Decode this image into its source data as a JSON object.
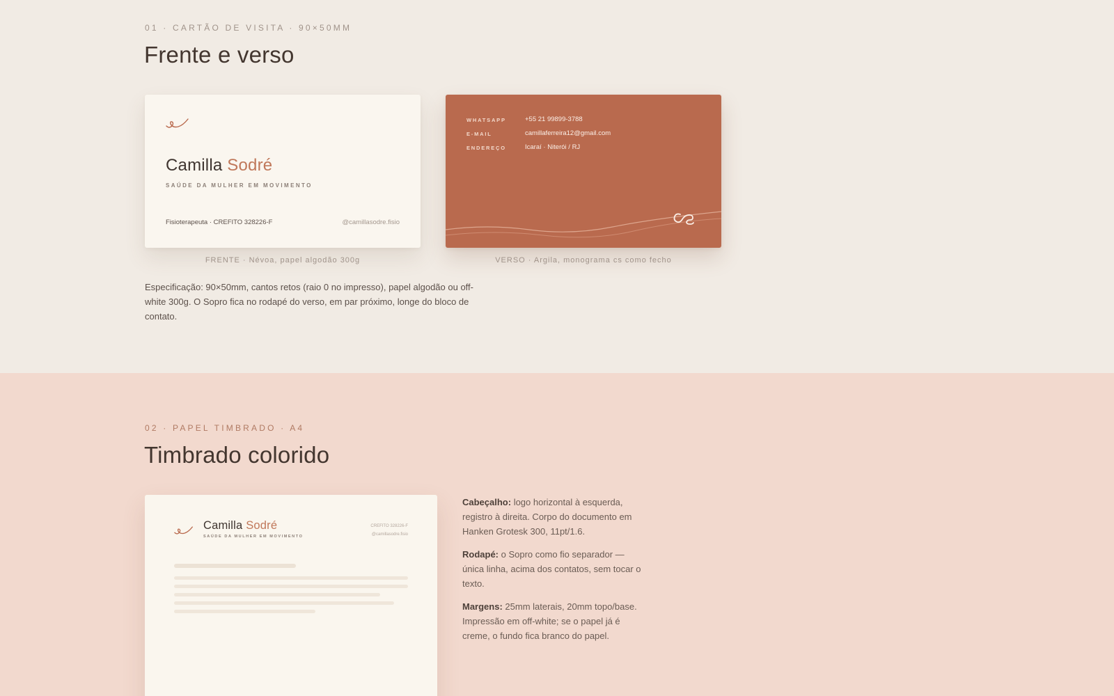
{
  "section1": {
    "eyebrow": "01 · CARTÃO DE VISITA · 90×50MM",
    "title": "Frente e verso",
    "front": {
      "first_name": "Camilla",
      "last_name": "Sodré",
      "tagline": "SAÚDE DA MULHER EM MOVIMENTO",
      "footer_left": "Fisioterapeuta · CREFITO 328226-F",
      "footer_right": "@camillasodre.fisio",
      "caption": "FRENTE · Névoa, papel algodão 300g"
    },
    "back": {
      "contacts": [
        {
          "label": "WHATSAPP",
          "value": "+55 21 99899-3788"
        },
        {
          "label": "E-MAIL",
          "value": "camillaferreira12@gmail.com"
        },
        {
          "label": "ENDEREÇO",
          "value": "Icaraí · Niterói / RJ"
        }
      ],
      "caption": "VERSO · Argila, monograma cs como fecho"
    },
    "spec": "Especificação: 90×50mm, cantos retos (raio 0 no impresso), papel algodão ou off-white 300g. O Sopro fica no rodapé do verso, em par próximo, longe do bloco de contato."
  },
  "section2": {
    "eyebrow": "02 · PAPEL TIMBRADO · A4",
    "title": "Timbrado colorido",
    "letterhead": {
      "first_name": "Camilla",
      "last_name": "Sodré",
      "tagline": "SAÚDE DA MULHER EM MOVIMENTO",
      "reg_line1": "CREFITO 328226-F",
      "reg_line2": "@camillasodre.fisio"
    },
    "notes": [
      {
        "key": "Cabeçalho:",
        "text": " logo horizontal à esquerda, registro à direita. Corpo do documento em Hanken Grotesk 300, 11pt/1.6."
      },
      {
        "key": "Rodapé:",
        "text": " o Sopro como fio separador — única linha, acima dos contatos, sem tocar o texto."
      },
      {
        "key": "Margens:",
        "text": " 25mm laterais, 20mm topo/base. Impressão em off-white; se o papel já é creme, o fundo fica branco do papel."
      }
    ]
  },
  "colors": {
    "accent": "#c0785a",
    "clay": "#b96a4e",
    "mist": "#faf6ef",
    "page_bg": "#f1ebe4",
    "blush_bg": "#f2d9ce"
  },
  "icons": {
    "front_mark": "sopro-breath-icon",
    "back_monogram": "cs-monogram-icon"
  }
}
